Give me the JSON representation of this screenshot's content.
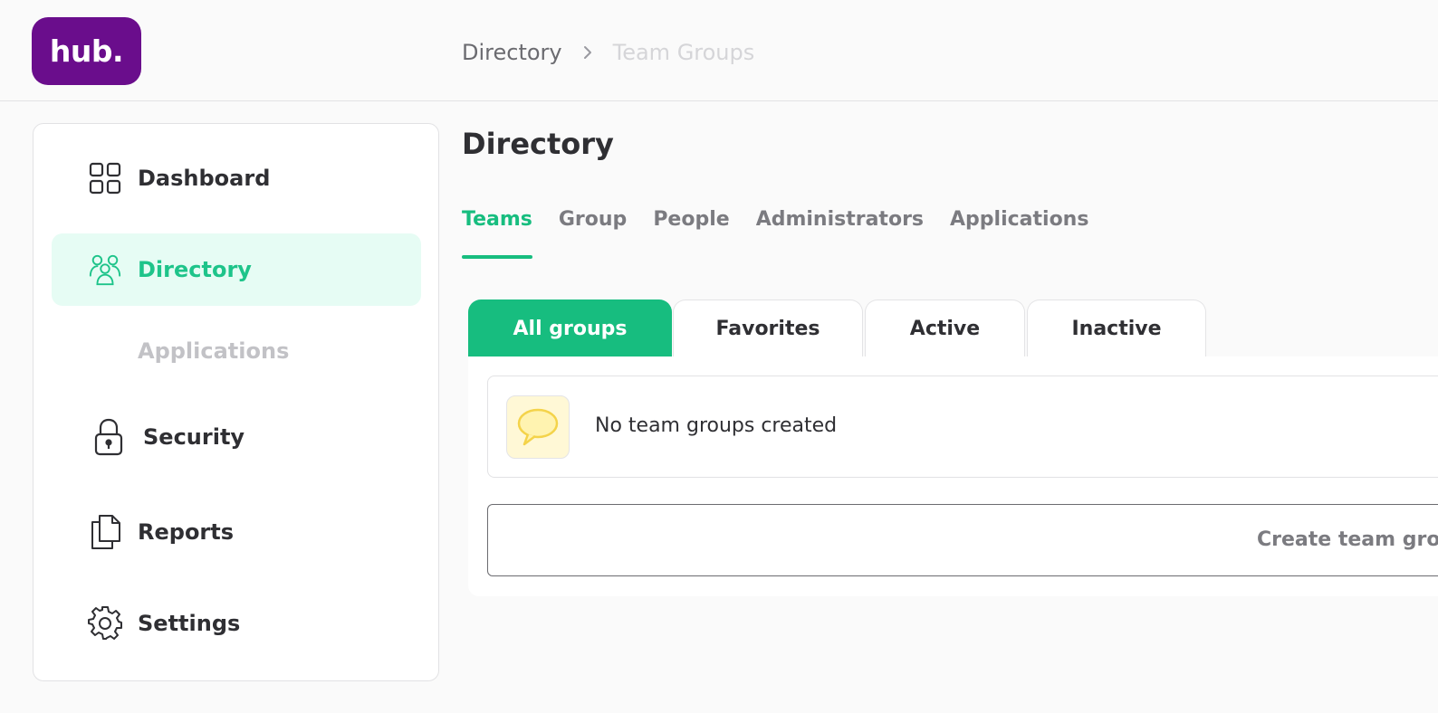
{
  "app": {
    "logo_text": "hub."
  },
  "breadcrumb": {
    "items": [
      "Directory",
      "Team Groups"
    ]
  },
  "sidebar": {
    "items": [
      {
        "label": "Dashboard",
        "icon": "grid-icon"
      },
      {
        "label": "Directory",
        "icon": "users-icon",
        "active": true
      },
      {
        "label": "Applications",
        "sub": true
      },
      {
        "label": "Security",
        "icon": "lock-icon"
      },
      {
        "label": "Reports",
        "icon": "documents-icon"
      },
      {
        "label": "Settings",
        "icon": "gear-icon"
      }
    ]
  },
  "main": {
    "title": "Directory",
    "tabs": [
      {
        "label": "Teams",
        "active": true
      },
      {
        "label": "Group"
      },
      {
        "label": "People"
      },
      {
        "label": "Administrators"
      },
      {
        "label": "Applications"
      }
    ],
    "filters": [
      {
        "label": "All groups",
        "active": true
      },
      {
        "label": "Favorites"
      },
      {
        "label": "Active"
      },
      {
        "label": "Inactive"
      }
    ],
    "empty_state": {
      "text": "No team groups created",
      "icon": "speech-bubble-icon"
    },
    "create_button": {
      "label": "Create team group"
    }
  },
  "colors": {
    "brand": "#6a0d8c",
    "accent": "#17bd7f",
    "active_nav_bg": "#e6fcf4"
  }
}
